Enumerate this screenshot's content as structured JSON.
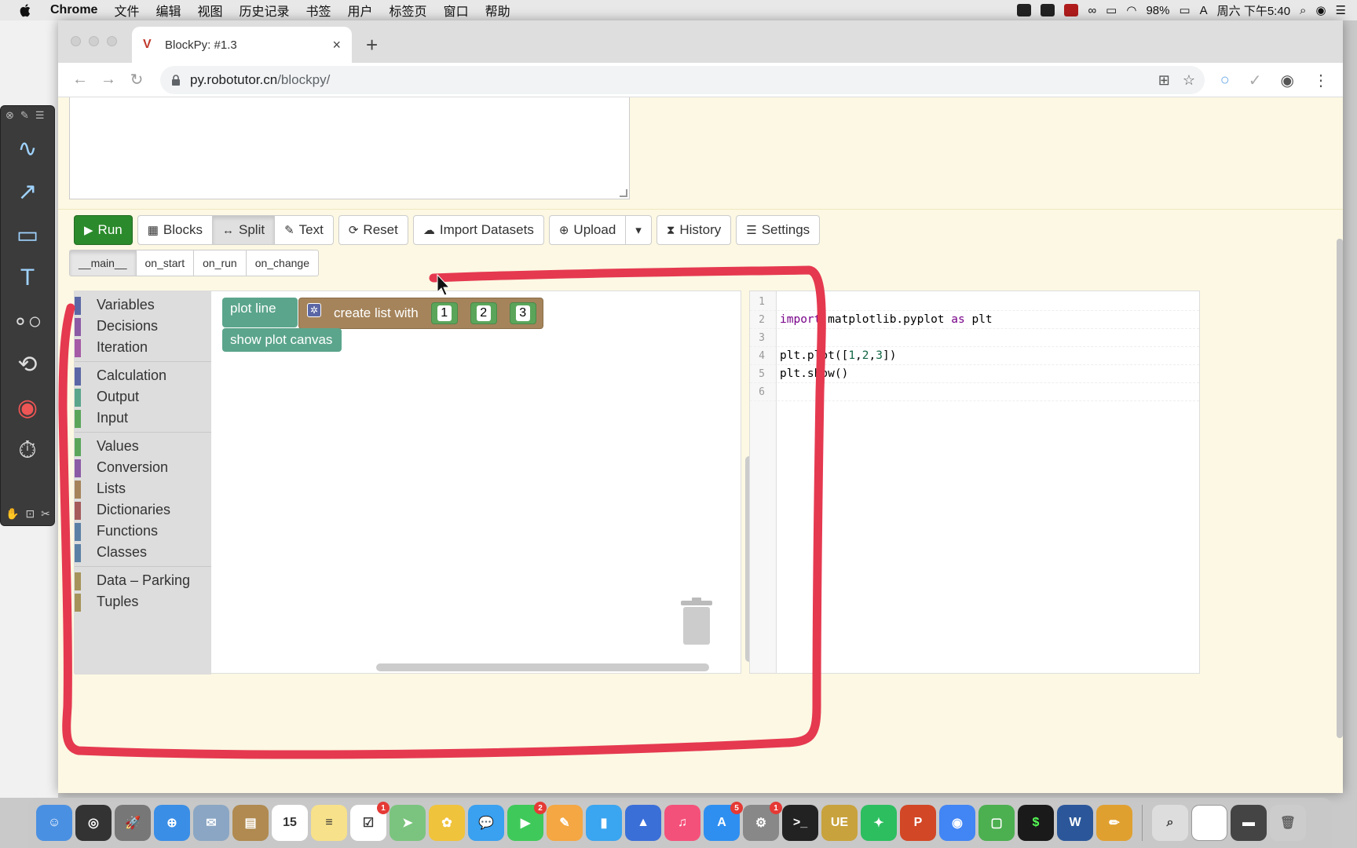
{
  "menubar": {
    "app_name": "Chrome",
    "items": [
      "文件",
      "编辑",
      "视图",
      "历史记录",
      "书签",
      "用户",
      "标签页",
      "窗口",
      "帮助"
    ],
    "battery": "98%",
    "clock": "周六 下午5:40",
    "input_source": "A"
  },
  "browser": {
    "tab_title": "BlockPy: #1.3",
    "url_domain": "py.robotutor.cn",
    "url_path": "/blockpy/"
  },
  "toolbar": {
    "run": "Run",
    "blocks": "Blocks",
    "split": "Split",
    "text": "Text",
    "reset": "Reset",
    "import_datasets": "Import Datasets",
    "upload": "Upload",
    "history": "History",
    "settings": "Settings"
  },
  "event_tabs": [
    "__main__",
    "on_start",
    "on_run",
    "on_change"
  ],
  "toolbox": {
    "group1": [
      {
        "label": "Variables",
        "color": "#5b67a5"
      },
      {
        "label": "Decisions",
        "color": "#8c5ba5"
      },
      {
        "label": "Iteration",
        "color": "#a55ba5"
      }
    ],
    "group2": [
      {
        "label": "Calculation",
        "color": "#5b67a5"
      },
      {
        "label": "Output",
        "color": "#5ba58c"
      },
      {
        "label": "Input",
        "color": "#5ba55b"
      }
    ],
    "group3": [
      {
        "label": "Values",
        "color": "#5ba55b"
      },
      {
        "label": "Conversion",
        "color": "#8c5ba5"
      },
      {
        "label": "Lists",
        "color": "#a5845b"
      },
      {
        "label": "Dictionaries",
        "color": "#a55b5b"
      },
      {
        "label": "Functions",
        "color": "#5b80a5"
      },
      {
        "label": "Classes",
        "color": "#5b80a5"
      }
    ],
    "group4": [
      {
        "label": "Data – Parking",
        "color": "#a5935b"
      },
      {
        "label": "Tuples",
        "color": "#a5935b"
      }
    ]
  },
  "blocks": {
    "plot_line": "plot line",
    "create_list": "create list with",
    "items": [
      "1",
      "2",
      "3"
    ],
    "show_canvas": "show plot canvas"
  },
  "code": {
    "lines": [
      "1",
      "2",
      "3",
      "4",
      "5",
      "6"
    ],
    "import_kw": "import",
    "import_mod": "matplotlib.pyplot",
    "as_kw": "as",
    "alias": "plt",
    "plot_prefix": "plt.plot([",
    "plot_nums": [
      "1",
      "2",
      "3"
    ],
    "plot_suffix": "])",
    "show_call": "plt.show()"
  },
  "dock": {
    "calendar_day": "15",
    "badges": {
      "reminders": "1",
      "facetime": "2",
      "appstore": "5",
      "prefs": "1"
    }
  },
  "colors": {
    "run_button": "#2b8a2b",
    "page_background": "#fcf8e3",
    "annotation_red": "#e53950"
  }
}
